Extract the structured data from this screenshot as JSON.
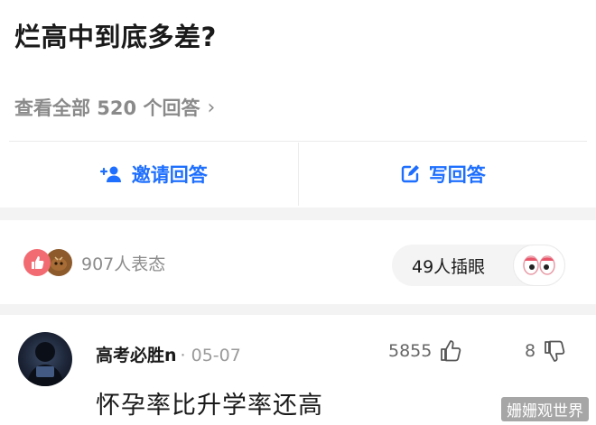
{
  "question": {
    "title": "烂高中到底多差?"
  },
  "view_all": {
    "label": "查看全部 520 个回答",
    "chevron": "›"
  },
  "actions": {
    "invite": {
      "label": "邀请回答",
      "icon": "add-user-icon"
    },
    "write": {
      "label": "写回答",
      "icon": "edit-icon"
    }
  },
  "reactions": {
    "count_label": "907人表态",
    "poke_label": "49人插眼"
  },
  "answer": {
    "author": "高考必胜n",
    "date": "· 05-07",
    "upvotes": "5855",
    "downvotes": "8",
    "text": "怀孕率比升学率还高"
  },
  "watermark": "姗姗观世界",
  "colors": {
    "accent": "#1e6fff",
    "like_red": "#f26b72",
    "text_gray": "#8c8c8c"
  }
}
